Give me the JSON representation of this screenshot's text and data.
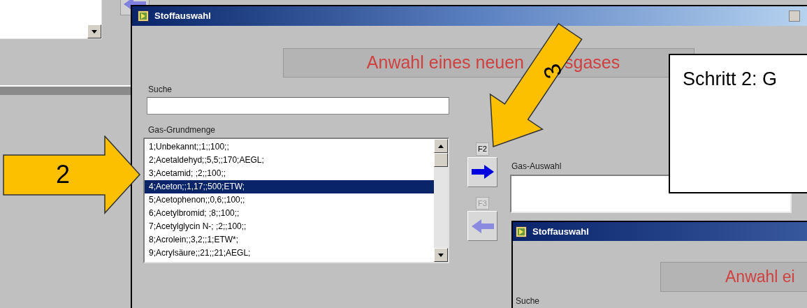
{
  "dialog": {
    "title": "Stoffauswahl",
    "banner": [
      "Anwahl eines neuen",
      "sgases"
    ],
    "search": {
      "label": "Suche"
    },
    "list": {
      "label": "Gas-Grundmenge",
      "items": [
        {
          "text": "1;Unbekannt;;1;;100;;",
          "selected": false
        },
        {
          "text": "2;Acetaldehyd;;5,5;;170;AEGL;",
          "selected": false
        },
        {
          "text": "3;Acetamid; ;2;;100;;",
          "selected": false
        },
        {
          "text": "4;Aceton;;1,17;;500;ETW;",
          "selected": true
        },
        {
          "text": "5;Acetophenon;;0,6;;100;;",
          "selected": false
        },
        {
          "text": "6;Acetylbromid; ;8;;100;;",
          "selected": false
        },
        {
          "text": "7;Acetylglycin N-; ;2;;100;;",
          "selected": false
        },
        {
          "text": "8;Acrolein;;3,2;;1;ETW*;",
          "selected": false
        },
        {
          "text": "9;Acrylsäure;;21;;21;AEGL;",
          "selected": false
        }
      ]
    },
    "transfer_buttons": [
      {
        "key": "F2",
        "kind": "add",
        "disabled": false
      },
      {
        "key": "F3",
        "kind": "remove",
        "disabled": true
      }
    ],
    "selection": {
      "label": "Gas-Auswahl"
    }
  },
  "second_dialog": {
    "title": "Stoffauswahl",
    "banner": "Anwahl ei",
    "search_label": "Suche"
  },
  "callout": "Schritt 2: G",
  "annotations": [
    {
      "label": "2",
      "kind": "right"
    },
    {
      "label": "3",
      "kind": "down-left"
    }
  ]
}
